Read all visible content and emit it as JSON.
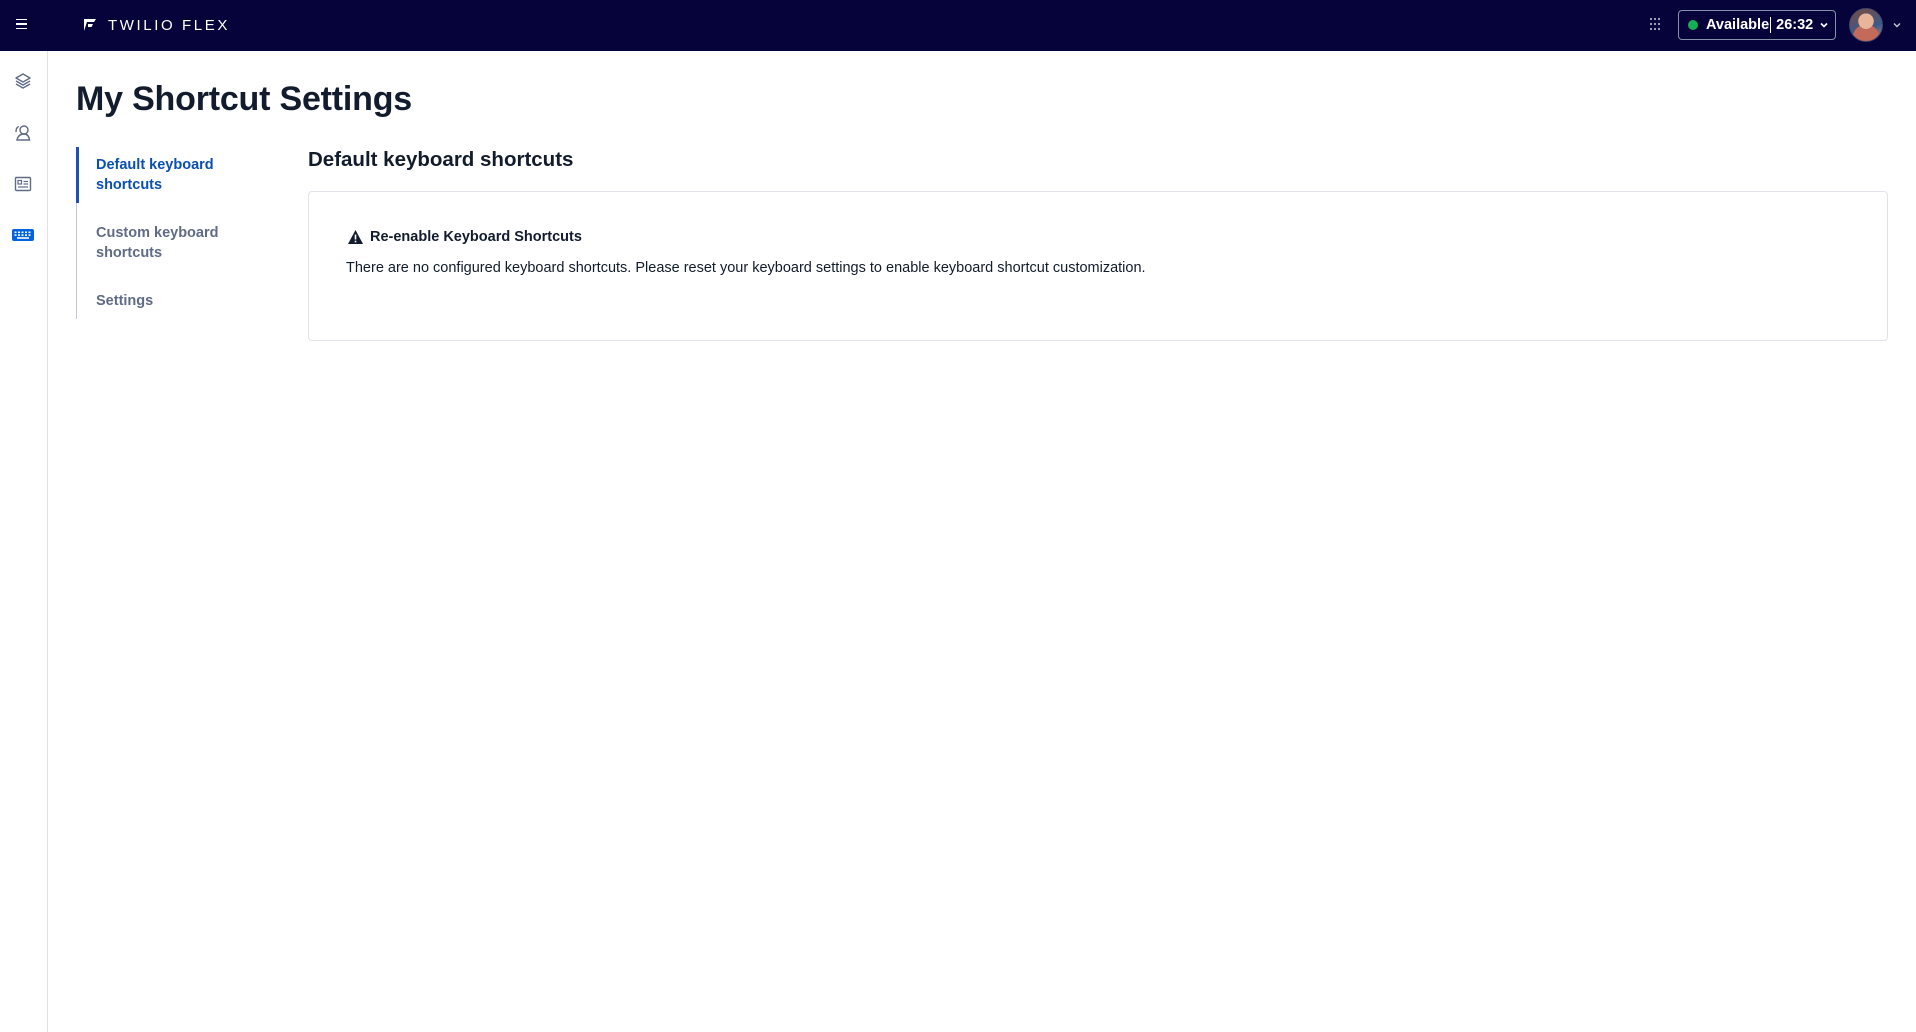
{
  "topbar": {
    "brand": "TWILIO FLEX",
    "status": {
      "label": "Available",
      "timer": "26:32",
      "dot_color": "#14b053"
    },
    "icons": [
      "menu-icon",
      "twilio-logo-icon",
      "apps-grid-icon",
      "chevron-down-icon",
      "avatar"
    ]
  },
  "rail": {
    "items": [
      {
        "icon": "layers-icon",
        "active": false
      },
      {
        "icon": "agent-icon",
        "active": false
      },
      {
        "icon": "contact-card-icon",
        "active": false
      },
      {
        "icon": "keyboard-icon",
        "active": true
      }
    ]
  },
  "page": {
    "title": "My Shortcut Settings"
  },
  "subnav": {
    "items": [
      {
        "label": "Default keyboard shortcuts",
        "active": true
      },
      {
        "label": "Custom keyboard shortcuts",
        "active": false
      },
      {
        "label": "Settings",
        "active": false
      }
    ]
  },
  "main": {
    "section_title": "Default keyboard shortcuts",
    "notice": {
      "icon": "warning-icon",
      "title": "Re-enable Keyboard Shortcuts",
      "body": "There are no configured keyboard shortcuts. Please reset your keyboard settings to enable keyboard shortcut customization."
    }
  },
  "colors": {
    "topbar_bg": "#06033a",
    "accent": "#0263e0",
    "text": "#121c2d",
    "muted": "#606b85"
  }
}
